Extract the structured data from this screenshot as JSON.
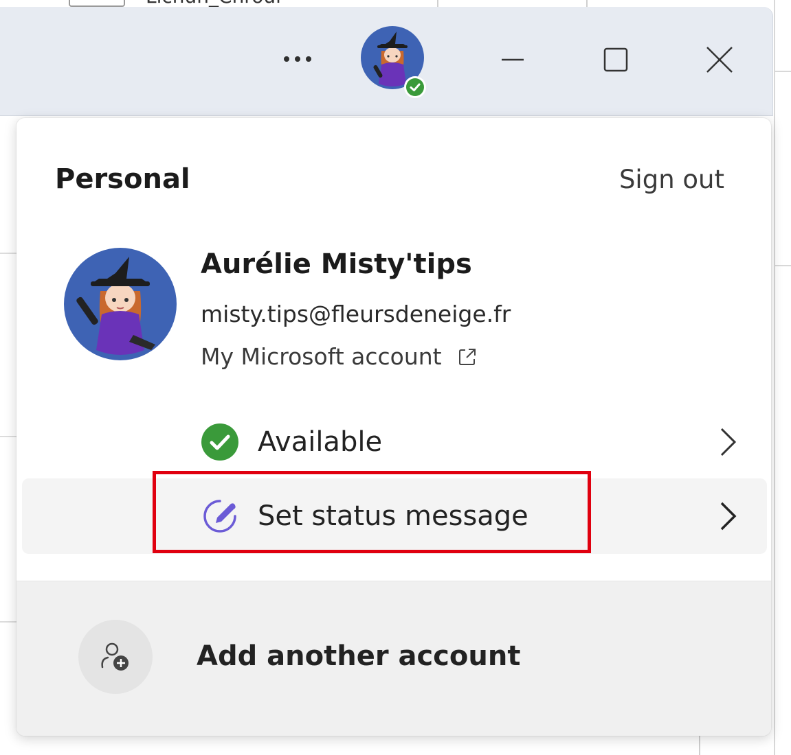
{
  "background_window": {
    "tab_text": "Lichun_Chroul"
  },
  "titlebar": {
    "more_label": "...",
    "presence_status": "available"
  },
  "account_menu": {
    "section_title": "Personal",
    "sign_out_label": "Sign out",
    "user_name": "Aurélie Misty'tips",
    "user_email": "misty.tips@fleursdeneige.fr",
    "account_link_label": "My Microsoft account",
    "presence": {
      "label": "Available",
      "color": "#3a9a3a"
    },
    "status_message": {
      "label": "Set status message",
      "icon_color": "#6b5bd6"
    },
    "add_account_label": "Add another account"
  },
  "annotation": {
    "highlight_color": "#e0000f",
    "highlighted_item": "Set status message"
  }
}
